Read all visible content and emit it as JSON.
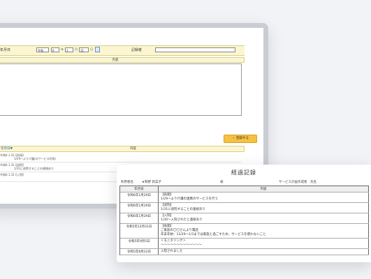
{
  "form": {
    "date_label": "年月日",
    "era_value": "令和",
    "year_value": "6",
    "year_unit": "年",
    "month_value": "1",
    "month_unit": "月",
    "day_value": "31",
    "day_unit": "日",
    "recorder_label": "記録者"
  },
  "content_header": "内容",
  "register_button": "・ 登録する",
  "list": {
    "date_header": "年月日▼",
    "content_header": "内容",
    "rows": [
      {
        "date": "令和6.1.31",
        "line1": "【再発】",
        "line2": "1/29〜より介護(のサービス利用)"
      },
      {
        "date": "令和6.1.31",
        "line1": "【退院】",
        "line2": "1/31に退院することの連絡あり"
      },
      {
        "date": "令和6.1.31",
        "line1": "【入院】",
        "line2": ""
      }
    ]
  },
  "paper": {
    "title": "経過記録",
    "user_label": "利用者名",
    "user_name": "★和野 新菜子",
    "honorific": "様",
    "service_label": "サービス計画作成者　氏名",
    "col_date": "年月日",
    "col_content": "内容",
    "rows": [
      {
        "date": "令和6年1月29日",
        "lines": [
          "【再発】",
          "1/29〜より介護の連携のサービスを行う"
        ]
      },
      {
        "date": "令和6年1月29日",
        "lines": [
          "【退院】",
          "1/31に退院することの連絡あり"
        ]
      },
      {
        "date": "令和6年1月29日",
        "lines": [
          "【入院】",
          "1/30〜入院されたと連絡あり"
        ]
      },
      {
        "date": "令和5年12月31日",
        "lines": [
          "【再発】",
          "ご家族の〇〇さんより電話",
          "年末年始：12/29〜1/3までは家族と過ごすため、サービスを使わないこと"
        ]
      },
      {
        "date": "令和5年9月5日",
        "lines": [
          "＜モニタリング＞",
          "〜〜〜〜〜〜〜〜〜〜〜〜〜"
        ]
      },
      {
        "date": "令和5年8月22日",
        "lines": [
          "入院されました"
        ]
      }
    ]
  }
}
